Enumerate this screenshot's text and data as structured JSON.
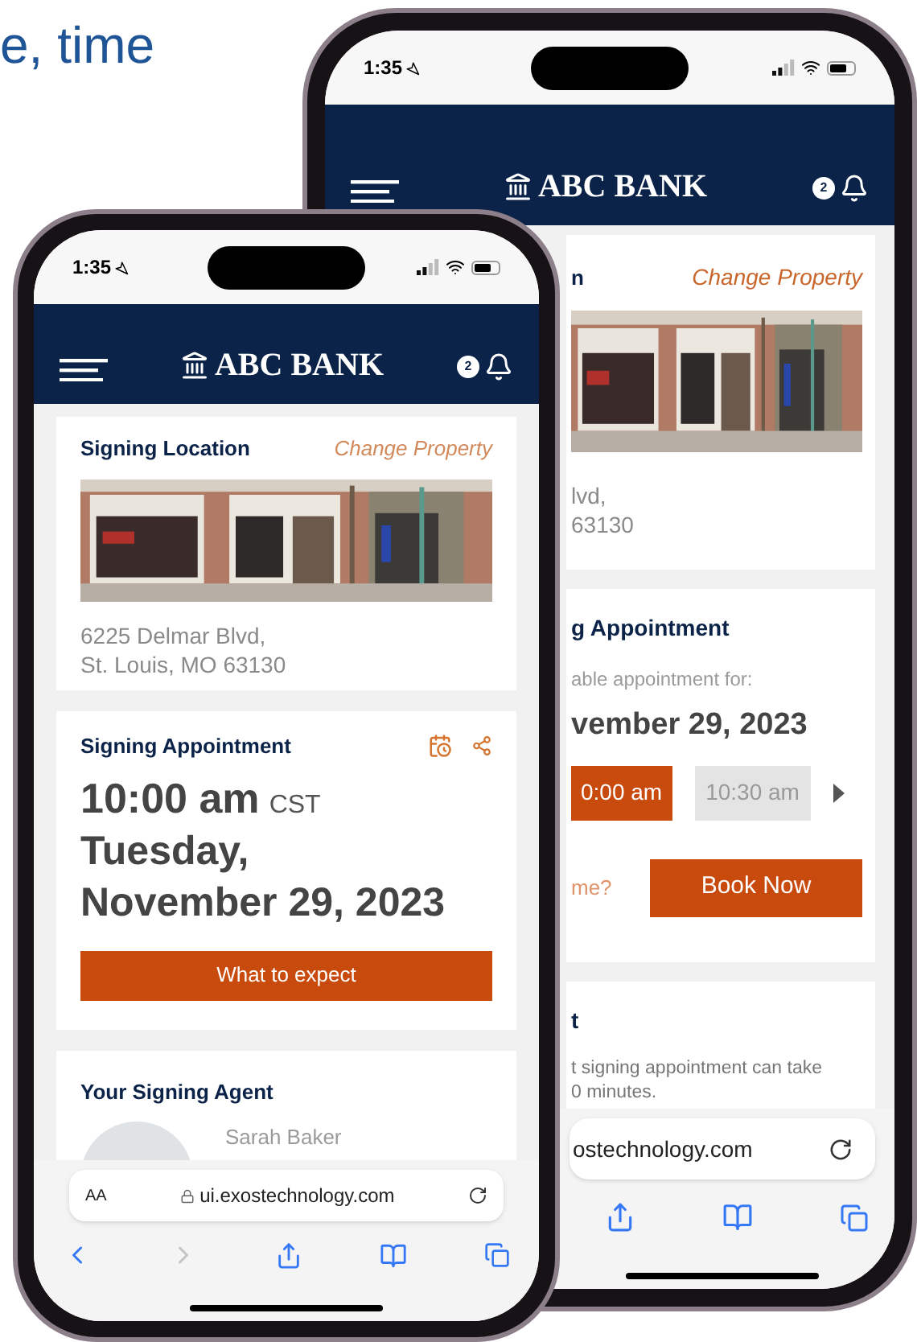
{
  "headline": "e, time",
  "back_phone": {
    "status_time": "1:35",
    "brand": "ABC BANK",
    "notification_count": "2",
    "location_card": {
      "title_fragment": "n",
      "action": "Change Property",
      "address_lines": [
        "lvd,",
        "63130"
      ]
    },
    "appointment_card": {
      "title": "g Appointment",
      "prompt": "able appointment for:",
      "date": "vember 29, 2023",
      "slots": [
        {
          "label": "0:00 am",
          "selected": true
        },
        {
          "label": "10:30 am",
          "selected": false
        }
      ],
      "link": "me?",
      "book_button": "Book Now"
    },
    "info_card": {
      "title": "t",
      "body_lines": [
        "t signing appointment can take",
        "0 minutes."
      ]
    },
    "browser": {
      "url": "ostechnology.com"
    }
  },
  "front_phone": {
    "status_time": "1:35",
    "brand": "ABC BANK",
    "notification_count": "2",
    "location_card": {
      "title": "Signing Location",
      "action": "Change Property",
      "address_lines": [
        "6225 Delmar Blvd,",
        "St. Louis, MO 63130"
      ]
    },
    "appointment_card": {
      "title": "Signing Appointment",
      "time": "10:00 am",
      "timezone": "CST",
      "date_lines": [
        "Tuesday,",
        "November 29, 2023"
      ],
      "button": "What to expect"
    },
    "agent_card": {
      "title": "Your Signing Agent",
      "name": "Sarah Baker"
    },
    "browser": {
      "text_size": "AA",
      "url": "ui.exostechnology.com",
      "back_disabled": false,
      "forward_disabled": true
    }
  }
}
